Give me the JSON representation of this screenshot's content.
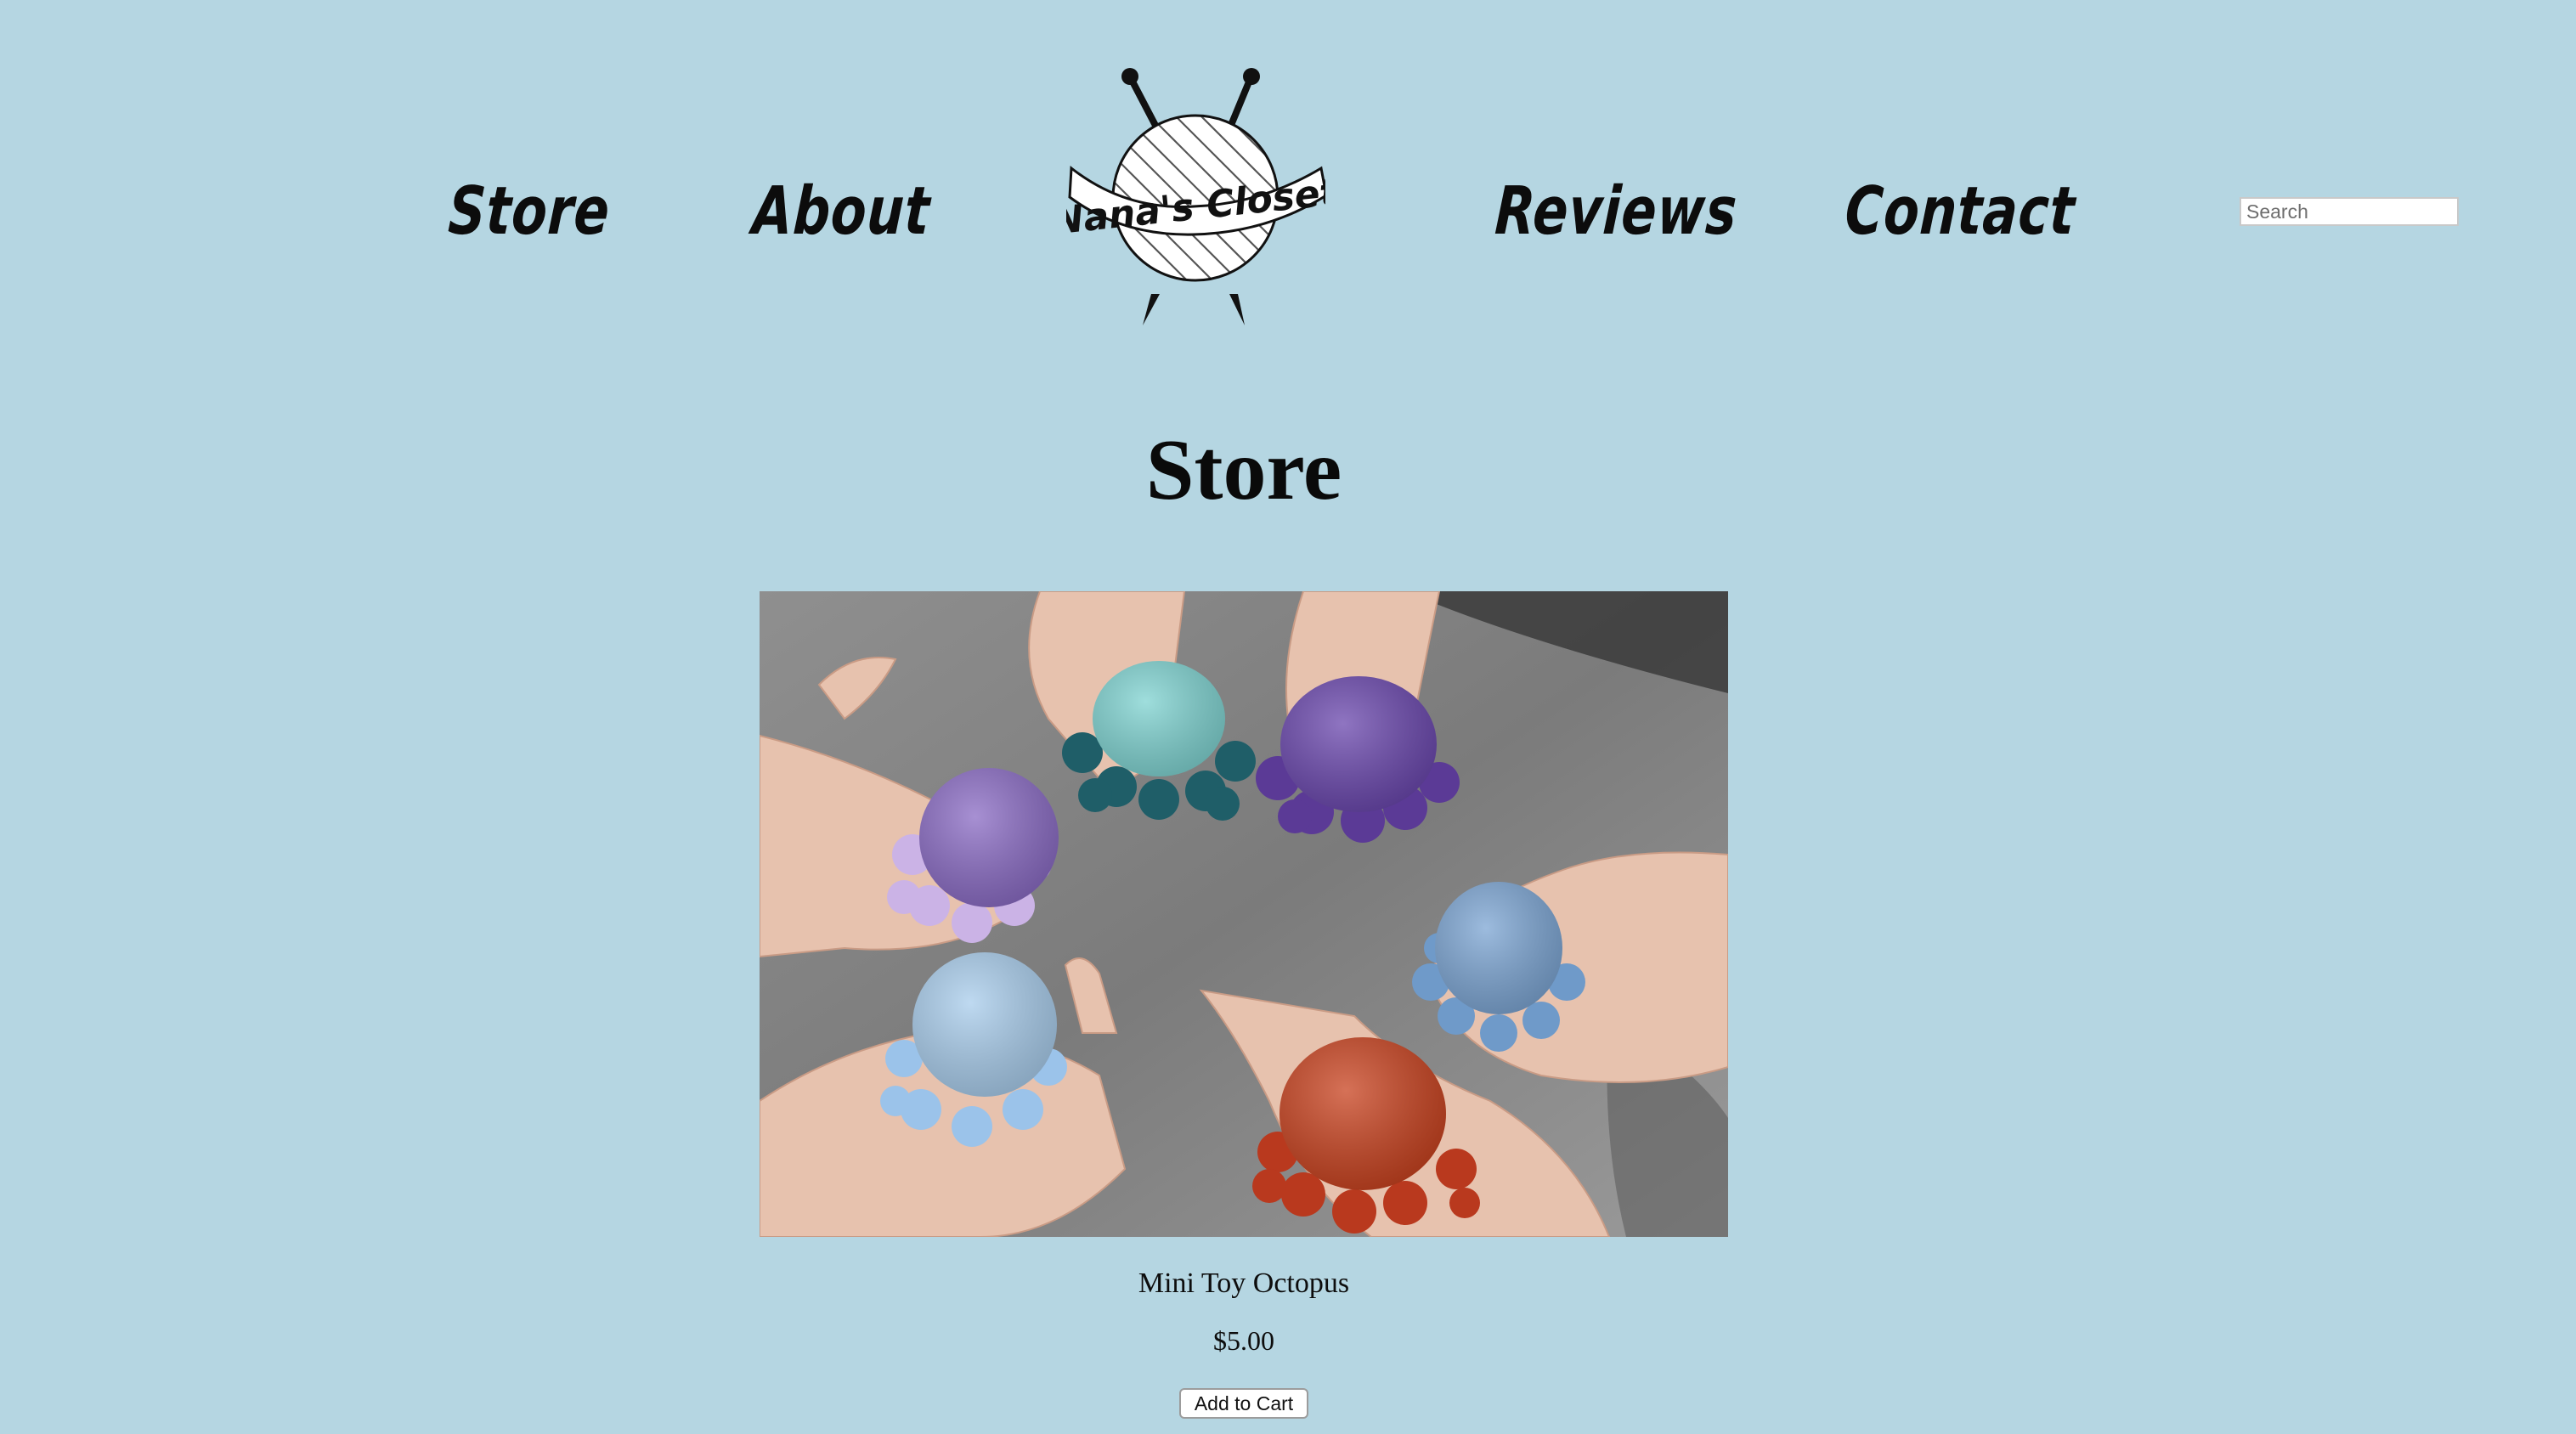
{
  "nav": {
    "store": "Store",
    "about": "About",
    "reviews": "Reviews",
    "contact": "Contact"
  },
  "logo": {
    "text": "Nana's Closet",
    "icon": "yarn-ball-with-needles-icon"
  },
  "search": {
    "placeholder": "Search",
    "value": ""
  },
  "page": {
    "title": "Store"
  },
  "products": [
    {
      "name": "Mini Toy Octopus",
      "price": "$5.00",
      "button_label": "Add to Cart"
    }
  ],
  "colors": {
    "background": "#b5d6e2",
    "text": "#0a0a0a"
  }
}
